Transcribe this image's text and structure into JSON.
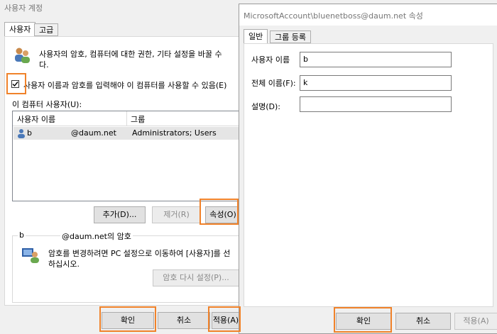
{
  "left_window": {
    "title": "사용자 계정",
    "tabs": [
      "사용자",
      "고급"
    ],
    "intro_text_line1": "사용자의 암호, 컴퓨터에 대한 권한, 기타 설정을 바꿀 수",
    "intro_text_line2": "다.",
    "require_password_checkbox": {
      "label": "사용자 이름과 암호를 입력해야 이 컴퓨터를 사용할 수 있음(E)",
      "checked": true
    },
    "users_label": "이 컴퓨터 사용자(U):",
    "columns": [
      "사용자 이름",
      "그룹"
    ],
    "rows": [
      {
        "name": "b",
        "email": "@daum.net",
        "group": "Administrators; Users"
      }
    ],
    "buttons": {
      "add": "추가(D)...",
      "remove": "제거(R)",
      "properties": "속성(O)"
    },
    "password_section": {
      "user": "b",
      "title": "@daum.net의 암호",
      "text_line1": "암호를 변경하려면 PC 설정으로 이동하여 [사용자]를 선",
      "text_line2": "하십시오.",
      "reset_button": "암호 다시 설정(P)..."
    },
    "footer": {
      "ok": "확인",
      "cancel": "취소",
      "apply": "적용(A)"
    }
  },
  "right_window": {
    "title": "MicrosoftAccount\\bluenetboss@daum.net 속성",
    "tabs": [
      "일반",
      "그룹 등록"
    ],
    "fields": [
      {
        "label": "사용자 이름",
        "value": "b"
      },
      {
        "label": "전체 이름(F):",
        "value": "k"
      },
      {
        "label": "설명(D):",
        "value": ""
      }
    ],
    "footer": {
      "ok": "확인",
      "cancel": "취소",
      "apply": "적용(A)"
    }
  },
  "colors": {
    "highlight": "#f0822a",
    "selected_row": "#e5e5e5"
  }
}
